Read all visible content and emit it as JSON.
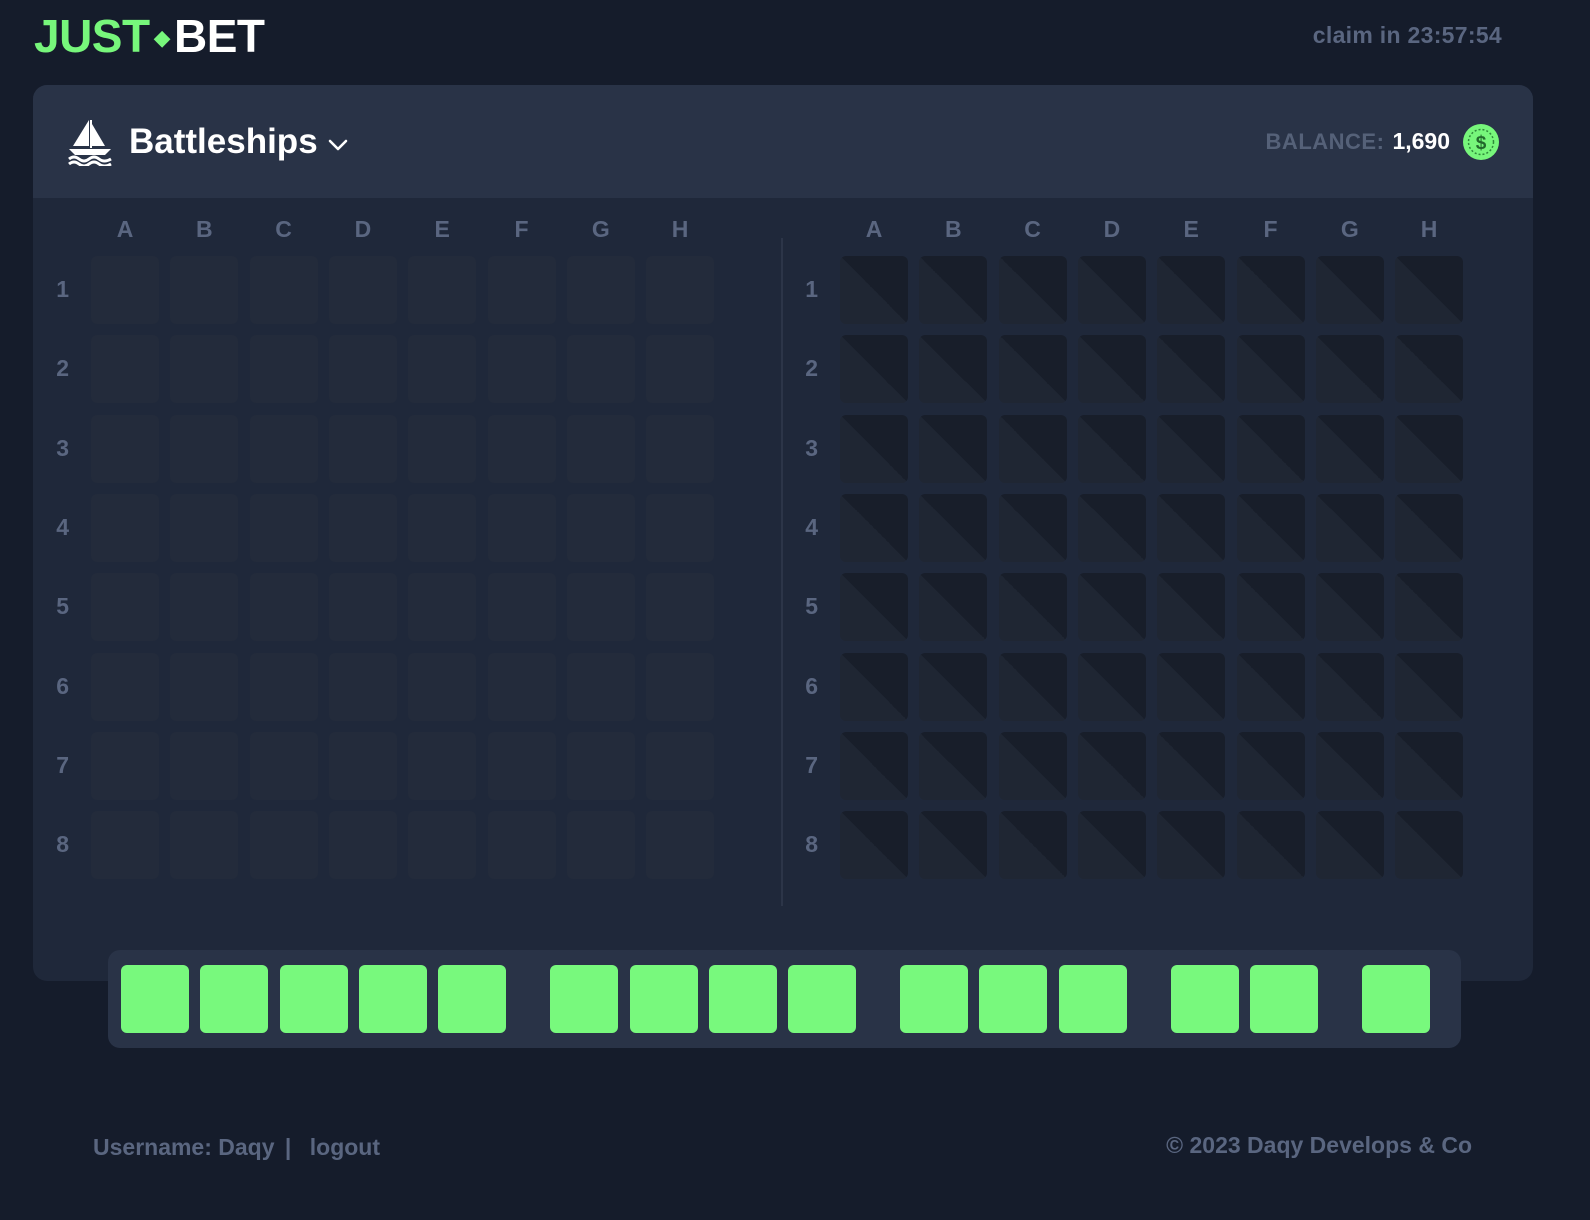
{
  "header": {
    "logo_part1": "JUST",
    "logo_part2": "BET",
    "claim_text": "claim in 23:57:54"
  },
  "game": {
    "icon": "sailboat-icon",
    "title": "Battleships",
    "balance_label": "BALANCE:",
    "balance_value": "1,690",
    "currency_icon": "dollar-coin-icon"
  },
  "boards": {
    "columns": [
      "A",
      "B",
      "C",
      "D",
      "E",
      "F",
      "G",
      "H"
    ],
    "rows": [
      "1",
      "2",
      "3",
      "4",
      "5",
      "6",
      "7",
      "8"
    ],
    "player_board_state": "empty",
    "enemy_board_state": "hidden"
  },
  "fleet": {
    "ships": [
      5,
      4,
      3,
      2,
      1
    ],
    "cell_color": "#78f97d"
  },
  "footer": {
    "username_label": "Username: Daqy",
    "separator": "|",
    "logout": "logout",
    "copyright": "© 2023 Daqy Develops & Co"
  },
  "colors": {
    "accent_green": "#77f67b",
    "background": "#151c2b",
    "card": "#1f283a",
    "card_header": "#293347",
    "muted_text": "#5a6680"
  }
}
